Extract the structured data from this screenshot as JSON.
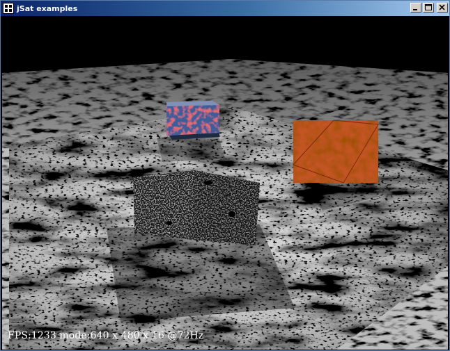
{
  "window": {
    "title": "jSat examples",
    "controls": [
      "minimize-icon",
      "maximize-icon",
      "close-icon"
    ]
  },
  "status": {
    "text": "FPS:1233 mode:640 x 480 x 16 @72Hz"
  }
}
